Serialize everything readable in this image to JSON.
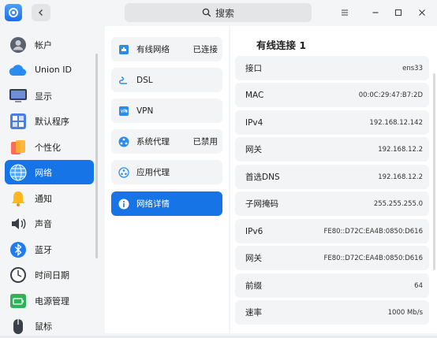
{
  "search": {
    "label": "搜索"
  },
  "sidebar": {
    "items": [
      {
        "label": "帐户",
        "icon": "account-icon"
      },
      {
        "label": "Union ID",
        "icon": "cloud-icon"
      },
      {
        "label": "显示",
        "icon": "display-icon"
      },
      {
        "label": "默认程序",
        "icon": "default-apps-icon"
      },
      {
        "label": "个性化",
        "icon": "personalization-icon"
      },
      {
        "label": "网络",
        "icon": "network-globe-icon",
        "active": true
      },
      {
        "label": "通知",
        "icon": "bell-icon"
      },
      {
        "label": "声音",
        "icon": "speaker-icon"
      },
      {
        "label": "蓝牙",
        "icon": "bluetooth-icon"
      },
      {
        "label": "时间日期",
        "icon": "clock-icon"
      },
      {
        "label": "电源管理",
        "icon": "battery-icon"
      },
      {
        "label": "鼠标",
        "icon": "mouse-icon"
      }
    ]
  },
  "network": {
    "items": [
      {
        "label": "有线网络",
        "status": "已连接",
        "icon": "wired-icon"
      },
      {
        "label": "DSL",
        "status": "",
        "icon": "dsl-icon"
      },
      {
        "label": "VPN",
        "status": "",
        "icon": "vpn-icon"
      },
      {
        "label": "系统代理",
        "status": "已禁用",
        "icon": "system-proxy-icon"
      },
      {
        "label": "应用代理",
        "status": "",
        "icon": "app-proxy-icon"
      },
      {
        "label": "网络详情",
        "status": "",
        "icon": "info-icon",
        "active": true
      }
    ]
  },
  "details": {
    "title": "有线连接 1",
    "rows": [
      {
        "label": "接口",
        "value": "ens33"
      },
      {
        "label": "MAC",
        "value": "00:0C:29:47:B7:2D"
      },
      {
        "label": "IPv4",
        "value": "192.168.12.142"
      },
      {
        "label": "网关",
        "value": "192.168.12.2"
      },
      {
        "label": "首选DNS",
        "value": "192.168.12.2"
      },
      {
        "label": "子网掩码",
        "value": "255.255.255.0"
      },
      {
        "label": "IPv6",
        "value": "FE80::D72C:EA4B:0850:D616"
      },
      {
        "label": "网关",
        "value": "FE80::D72C:EA4B:0850:D616"
      },
      {
        "label": "前缀",
        "value": "64"
      },
      {
        "label": "速率",
        "value": "1000 Mb/s"
      }
    ]
  },
  "colors": {
    "accent": "#1674e6",
    "background": "#f4f5f6",
    "panel": "#ffffff",
    "row": "#f3f4f5"
  }
}
